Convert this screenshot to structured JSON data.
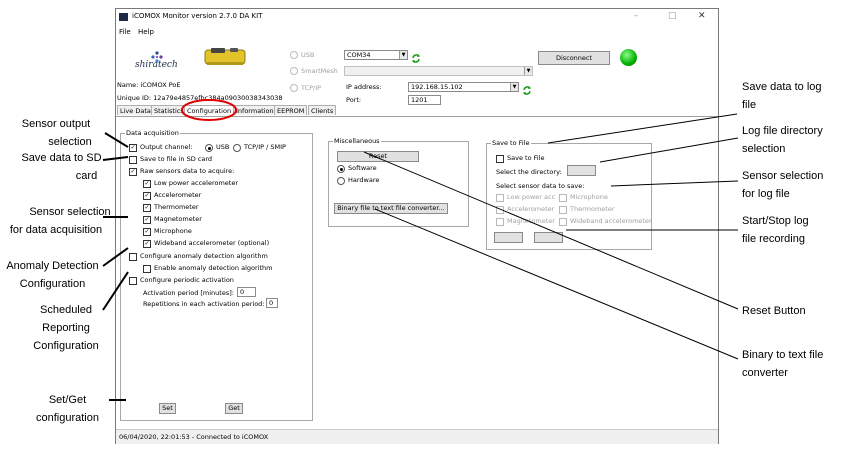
{
  "window": {
    "title": "iCOMOX Monitor version 2.7.0 DA KIT",
    "controls": [
      "–",
      "□",
      "✕"
    ]
  },
  "menu": [
    "File",
    "Help"
  ],
  "header": {
    "logo_text": "shiratech",
    "device_name": "Name: iCOMOX PoE",
    "unique_id": "Unique ID: 12a79e4857efbc384a09030038343038",
    "conn_usb": "USB",
    "conn_smartmesh": "SmartMesh",
    "conn_tcpip": "TCP/IP",
    "com_port": "COM34",
    "ip_label": "IP address:",
    "ip_value": "192.168.15.102",
    "port_label": "Port:",
    "port_value": "1201",
    "disconnect": "Disconnect",
    "status_color": "#00c000"
  },
  "tabs": [
    "Live Data",
    "Statistics",
    "Configuration",
    "Information",
    "EEPROM",
    "Clients"
  ],
  "data_acquisition": {
    "title": "Data acquisition",
    "output_channel": "Output channel:",
    "usb": "USB",
    "tcp": "TCP/IP / SMIP",
    "save_sd": "Save to file in SD card",
    "raw": "Raw sensors data to acquire:",
    "sensors": [
      "Low power accelerometer",
      "Accelerometer",
      "Thermometer",
      "Magnetometer",
      "Microphone",
      "Wideband accelerometer (optional)"
    ],
    "anomaly": "Configure anomaly detection algorithm",
    "enable_anomaly": "Enable anomaly detection algorithm",
    "periodic": "Configure periodic activation",
    "activation_period": "Activation period [minutes]:",
    "activation_value": "0",
    "repetitions": "Repetitions in each activation period:",
    "repetitions_value": "0",
    "set": "Set",
    "get": "Get"
  },
  "misc": {
    "title": "Miscellaneous",
    "reset": "Reset",
    "software": "Software",
    "hardware": "Hardware",
    "binary": "Binary file to text file converter..."
  },
  "save_to_file": {
    "title": "Save to File",
    "save": "Save to File",
    "select_dir": "Select the directory:",
    "select_sensor": "Select sensor data to save:",
    "sensors": [
      "Low power acc",
      "Microphone",
      "Accelerometer",
      "Thermometer",
      "Magnetometer",
      "Wideband accelerometer"
    ]
  },
  "status_bar": "06/04/2020, 22:01:53 - Connected to iCOMOX",
  "annotations": {
    "sensor_output": [
      "Sensor output",
      "selection"
    ],
    "save_sd": [
      "Save data to SD",
      "card"
    ],
    "sensor_acq": [
      "Sensor selection",
      "for data acquisition"
    ],
    "anomaly": [
      "Anomaly Detection",
      "Configuration"
    ],
    "scheduled": [
      "Scheduled",
      "Reporting",
      "Configuration"
    ],
    "setget": [
      "Set/Get",
      "configuration"
    ],
    "save_log": [
      "Save data to log",
      "file"
    ],
    "log_dir": [
      "Log file directory",
      "selection"
    ],
    "sensor_log": [
      "Sensor selection",
      "for log file"
    ],
    "startstop": [
      "Start/Stop log",
      "file recording"
    ],
    "reset": [
      "Reset Button"
    ],
    "binary": [
      "Binary to text file",
      "converter"
    ]
  }
}
